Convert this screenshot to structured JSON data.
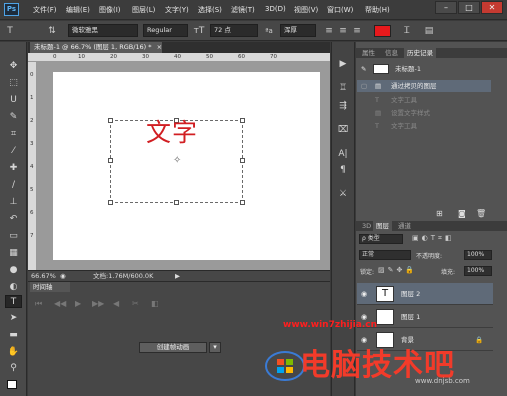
{
  "app": {
    "logo": "Ps",
    "menu": [
      "文件(F)",
      "编辑(E)",
      "图像(I)",
      "图层(L)",
      "文字(Y)",
      "选择(S)",
      "滤镜(T)",
      "3D(D)",
      "视图(V)",
      "窗口(W)",
      "帮助(H)"
    ],
    "window_buttons": {
      "minimize": "–",
      "maximize": "□",
      "close": "✕"
    }
  },
  "options_bar": {
    "font_family": "微软雅黑",
    "font_style": "Regular",
    "font_size": "72 点",
    "aa_label": "ªa",
    "antialias": "浑厚",
    "text_color": "#e8191c"
  },
  "document": {
    "tab_title": "未标题-1 @ 66.7% (图层 1, RGB/16) *",
    "tab_close": "×",
    "ruler_top": [
      "0",
      "10",
      "20",
      "30",
      "40",
      "50",
      "60",
      "70"
    ],
    "ruler_left": [
      "0",
      "1",
      "2",
      "3",
      "4",
      "5",
      "6",
      "7"
    ],
    "canvas_text": "文字",
    "zoom": "66.67%",
    "doc_info": "文档:1.76M/600.0K",
    "status_arrow": "▶"
  },
  "timeline": {
    "tab": "时间轴",
    "create_button": "创建帧动画",
    "dropdown": "▾"
  },
  "panels": {
    "history_tabs": [
      "属性",
      "信息",
      "历史记录"
    ],
    "history_snapshot": "未标题-1",
    "history_items": [
      "通过拷贝的图层",
      "文字工具",
      "设置文字样式",
      "文字工具"
    ],
    "layers_tabs": [
      "3D",
      "图层",
      "通道"
    ],
    "filter_kind": "ρ 类型",
    "blend_mode": "正常",
    "opacity_label": "不透明度:",
    "opacity": "100%",
    "lock_label": "锁定:",
    "fill_label": "填充:",
    "fill": "100%",
    "layers": [
      {
        "name": "图层 2",
        "thumb": "T"
      },
      {
        "name": "图层 1",
        "thumb": ""
      },
      {
        "name": "背景",
        "thumb": ""
      }
    ]
  },
  "watermark": {
    "url": "www.win7zhijia.cn",
    "title": "电脑技术吧",
    "sub": "www.dnjsb.com"
  }
}
